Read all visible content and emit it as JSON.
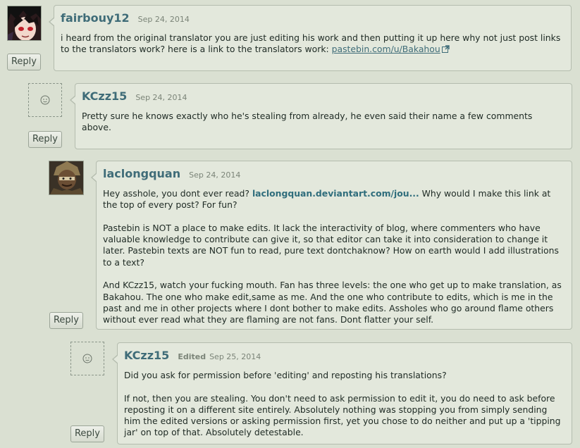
{
  "comments": [
    {
      "username": "fairbouy12",
      "date": "Sep 24, 2014",
      "reply_label": "Reply",
      "body": {
        "text": "i heard from the original translator you are just editing his work and then putting it up here why not just post links to the translators work? here is a link to the translators work: ",
        "link": "pastebin.com/u/Bakahou"
      }
    },
    {
      "username": "KCzz15",
      "date": "Sep 24, 2014",
      "reply_label": "Reply",
      "body": {
        "text": "Pretty sure he knows exactly who he's stealing from already, he even said their name a few comments above."
      }
    },
    {
      "username": "laclongquan",
      "date": "Sep 24, 2014",
      "reply_label": "Reply",
      "body": {
        "p1_before": "Hey asshole, you dont ever read? ",
        "p1_link": "laclongquan.deviantart.com/jou...",
        "p1_after": " Why would I make this link at the top of every post? For fun?",
        "p2": "Pastebin is NOT a place to make edits. It lack the interactivity of blog, where commenters who have valuable knowledge to contribute can give it, so that editor can take it into consideration to change it later. Pastebin texts are NOT fun to read, pure text dontchaknow? How on earth would I add illustrations to a text?",
        "p3": "And KCzz15, watch your fucking mouth. Fan has three levels: the one who get up to make translation, as Bakahou. The one who make edit,same as me. And the one who contribute to edits, which is me in the past and me in other projects where I dont bother to make edits. Assholes who go around flame others without ever read what they are flaming are not fans. Dont flatter your self."
      }
    },
    {
      "username": "KCzz15",
      "edited_label": "Edited",
      "date": "Sep 25, 2014",
      "reply_label": "Reply",
      "body": {
        "p1": "Did you ask for permission before 'editing' and reposting his translations?",
        "p2": "If not, then you are stealing. You don't need to ask permission to edit it, you do need to ask before reposting it on a different site entirely. Absolutely nothing was stopping you from simply sending him the edited versions or asking permission first, yet you chose to do neither and put up a 'tipping jar' on top of that. Absolutely detestable."
      }
    }
  ],
  "icons": {
    "blank_avatar": "smiley-icon",
    "external_link": "external-link-icon"
  },
  "colors": {
    "background": "#dae0d2",
    "bubble": "#e3e8dc",
    "username": "#3f6c78",
    "link": "#3f6c78"
  }
}
